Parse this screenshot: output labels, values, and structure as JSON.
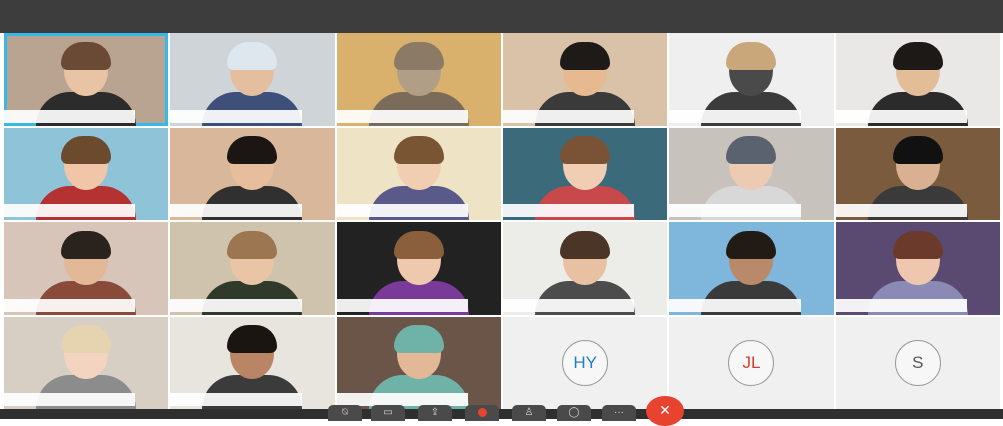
{
  "participants": [
    {
      "kind": "video",
      "bg": "#b9a491",
      "skin": "#e8c3a4",
      "hair": "#6b4a35",
      "shirt": "#2c2c2c",
      "label": ""
    },
    {
      "kind": "video",
      "bg": "#cfd4d9",
      "skin": "#e3bfa0",
      "hair": "#dfe7ee",
      "shirt": "#3e4f7a",
      "label": ""
    },
    {
      "kind": "video",
      "bg": "#d9b16c",
      "skin": "#b09e86",
      "hair": "#8a7a66",
      "shirt": "#7a6b5a",
      "label": ""
    },
    {
      "kind": "video",
      "bg": "#d9c2a7",
      "skin": "#e6b990",
      "hair": "#1d1a18",
      "shirt": "#3a3a3a",
      "label": ""
    },
    {
      "kind": "video",
      "bg": "#efefef",
      "skin": "#4a4a4a",
      "hair": "#c9a77a",
      "shirt": "#3b3b3b",
      "label": ""
    },
    {
      "kind": "video",
      "bg": "#e9e8e6",
      "skin": "#e3bc98",
      "hair": "#1d1917",
      "shirt": "#2b2b2b",
      "label": ""
    },
    {
      "kind": "video",
      "bg": "#8fc3d8",
      "skin": "#f1c5a8",
      "hair": "#6b4a2e",
      "shirt": "#b43232",
      "label": ""
    },
    {
      "kind": "video",
      "bg": "#d8b79a",
      "skin": "#e6be9c",
      "hair": "#1b1613",
      "shirt": "#303030",
      "label": ""
    },
    {
      "kind": "video",
      "bg": "#efe3c6",
      "skin": "#f1cdb1",
      "hair": "#7a5534",
      "shirt": "#5a5a8a",
      "label": ""
    },
    {
      "kind": "video",
      "bg": "#3b6a7a",
      "skin": "#f1cdb4",
      "hair": "#7a5236",
      "shirt": "#c7494a",
      "label": ""
    },
    {
      "kind": "video",
      "bg": "#c7c2bc",
      "skin": "#eccbb2",
      "hair": "#5a6270",
      "shirt": "#d8d8d8",
      "label": ""
    },
    {
      "kind": "video",
      "bg": "#7a5b3e",
      "skin": "#d9b092",
      "hair": "#111111",
      "shirt": "#3a3a3a",
      "label": ""
    },
    {
      "kind": "video",
      "bg": "#d6c5b8",
      "skin": "#e3b897",
      "hair": "#2a221c",
      "shirt": "#8a4a3a",
      "label": ""
    },
    {
      "kind": "video",
      "bg": "#cfc3ad",
      "skin": "#e9c4a5",
      "hair": "#9c7650",
      "shirt": "#2f3a2a",
      "label": ""
    },
    {
      "kind": "video",
      "bg": "#222222",
      "skin": "#efc9ad",
      "hair": "#8a5f3c",
      "shirt": "#7a3a9a",
      "label": ""
    },
    {
      "kind": "video",
      "bg": "#ecece8",
      "skin": "#e8c1a2",
      "hair": "#4a3526",
      "shirt": "#4c4c4c",
      "label": ""
    },
    {
      "kind": "video",
      "bg": "#7fb6dc",
      "skin": "#b98a6a",
      "hair": "#221a14",
      "shirt": "#3a3a3a",
      "label": ""
    },
    {
      "kind": "video",
      "bg": "#5a4a72",
      "skin": "#efc7ae",
      "hair": "#6b3a2a",
      "shirt": "#8a8ab4",
      "label": ""
    },
    {
      "kind": "video",
      "bg": "#d7cfc4",
      "skin": "#f3d4c0",
      "hair": "#e6d4b0",
      "shirt": "#8c8c8c",
      "label": ""
    },
    {
      "kind": "video",
      "bg": "#e8e4de",
      "skin": "#b98565",
      "hair": "#1b1512",
      "shirt": "#3b3b3b",
      "label": ""
    },
    {
      "kind": "video",
      "bg": "#6a5548",
      "skin": "#e2b897",
      "hair": "#6fb3a8",
      "shirt": "#6fb3a8",
      "label": ""
    },
    {
      "kind": "avatar",
      "initials": "HY",
      "color": "#1d7fc4",
      "label": ""
    },
    {
      "kind": "avatar",
      "initials": "JL",
      "color": "#d9382c",
      "label": ""
    },
    {
      "kind": "avatar",
      "initials": "S",
      "color": "#555555",
      "label": ""
    }
  ],
  "toolbar": {
    "buttons": [
      {
        "name": "mute-button",
        "icon": "microphone-off-icon",
        "glyph": "⍉"
      },
      {
        "name": "video-button",
        "icon": "video-off-icon",
        "glyph": "▭"
      },
      {
        "name": "share-button",
        "icon": "share-icon",
        "glyph": "⇪"
      },
      {
        "name": "record-button",
        "icon": "record-icon",
        "glyph": ""
      },
      {
        "name": "participants-button",
        "icon": "person-icon",
        "glyph": "♙"
      },
      {
        "name": "chat-button",
        "icon": "chat-icon",
        "glyph": "◯"
      },
      {
        "name": "more-button",
        "icon": "more-icon",
        "glyph": "···"
      }
    ],
    "end_glyph": "✕",
    "end_color": "#e8432e"
  }
}
